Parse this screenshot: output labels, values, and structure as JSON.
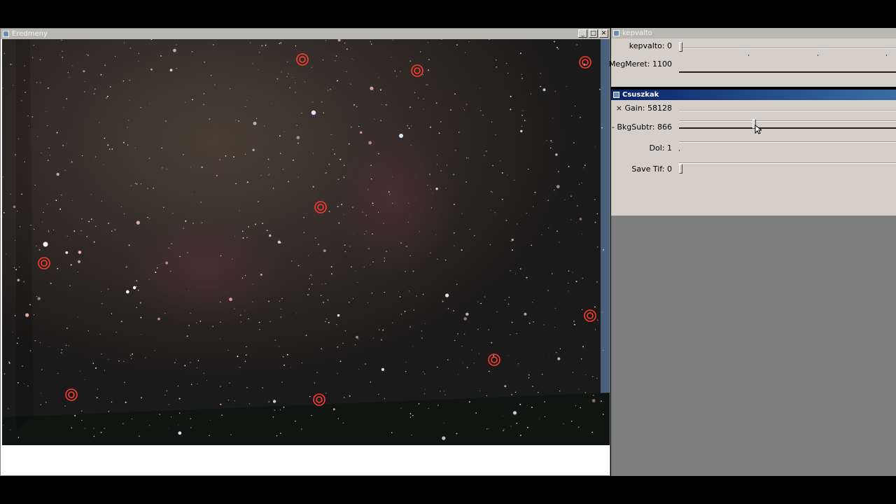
{
  "windows": {
    "image": {
      "title": "Eredmeny"
    },
    "kepvalto": {
      "title": "kepvalto",
      "sliders": [
        {
          "label": "kepvalto: 0",
          "level": 0.0
        },
        {
          "label": "MegMeret: 1100",
          "level": 1.0
        }
      ]
    },
    "csuszkak": {
      "title": "Csuszkak",
      "sliders": [
        {
          "label": "Gain: 58128",
          "prefix": "×",
          "level": 1.0
        },
        {
          "label": "BkgSubtr: 866",
          "prefix": "-",
          "level": 0.35
        },
        {
          "label": "Dol: 1",
          "prefix": "",
          "level": 0.0
        },
        {
          "label": "Save Tif: 0",
          "prefix": "",
          "level": 0.0
        }
      ]
    }
  },
  "colors": {
    "marker": "#ff3b2f",
    "active_title": "#0a246a",
    "sky": "#1a1816"
  }
}
